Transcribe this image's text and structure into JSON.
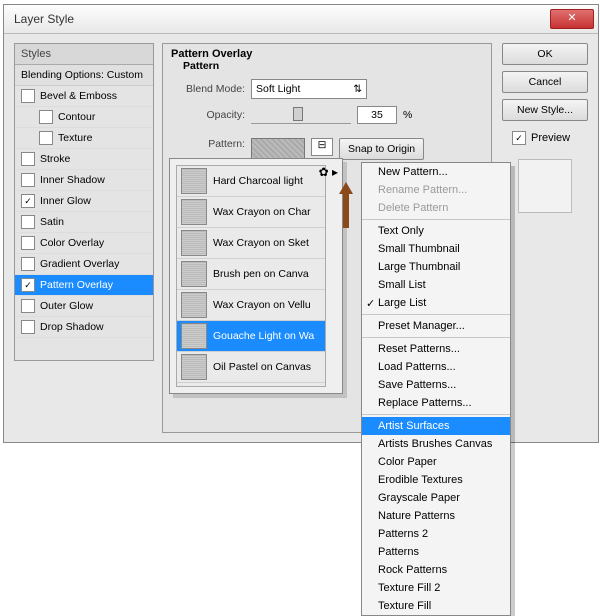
{
  "window": {
    "title": "Layer Style"
  },
  "styles_panel": {
    "header": "Styles",
    "subheader": "Blending Options: Custom",
    "items": [
      {
        "label": "Bevel & Emboss",
        "checked": false,
        "indent": false
      },
      {
        "label": "Contour",
        "checked": false,
        "indent": true
      },
      {
        "label": "Texture",
        "checked": false,
        "indent": true
      },
      {
        "label": "Stroke",
        "checked": false,
        "indent": false
      },
      {
        "label": "Inner Shadow",
        "checked": false,
        "indent": false
      },
      {
        "label": "Inner Glow",
        "checked": true,
        "indent": false
      },
      {
        "label": "Satin",
        "checked": false,
        "indent": false
      },
      {
        "label": "Color Overlay",
        "checked": false,
        "indent": false
      },
      {
        "label": "Gradient Overlay",
        "checked": false,
        "indent": false
      },
      {
        "label": "Pattern Overlay",
        "checked": true,
        "indent": false,
        "selected": true
      },
      {
        "label": "Outer Glow",
        "checked": false,
        "indent": false
      },
      {
        "label": "Drop Shadow",
        "checked": false,
        "indent": false
      }
    ]
  },
  "overlay": {
    "title": "Pattern Overlay",
    "section": "Pattern",
    "blend_label": "Blend Mode:",
    "blend_value": "Soft Light",
    "opacity_label": "Opacity:",
    "opacity_value": "35",
    "opacity_unit": "%",
    "pattern_label": "Pattern:",
    "snap_btn": "Snap to Origin"
  },
  "sidebar_buttons": {
    "ok": "OK",
    "cancel": "Cancel",
    "new_style": "New Style...",
    "preview": "Preview",
    "preview_checked": true
  },
  "pattern_list": [
    "Hard Charcoal light",
    "Wax Crayon on Char",
    "Wax Crayon on Sket",
    "Brush pen on Canva",
    "Wax Crayon on Vellu",
    "Gouache Light on Wa",
    "Oil Pastel on Canvas"
  ],
  "pattern_selected_index": 5,
  "context_menu": {
    "groups": [
      [
        {
          "label": "New Pattern..."
        },
        {
          "label": "Rename Pattern...",
          "disabled": true
        },
        {
          "label": "Delete Pattern",
          "disabled": true
        }
      ],
      [
        {
          "label": "Text Only"
        },
        {
          "label": "Small Thumbnail"
        },
        {
          "label": "Large Thumbnail"
        },
        {
          "label": "Small List"
        },
        {
          "label": "Large List",
          "checked": true
        }
      ],
      [
        {
          "label": "Preset Manager..."
        }
      ],
      [
        {
          "label": "Reset Patterns..."
        },
        {
          "label": "Load Patterns..."
        },
        {
          "label": "Save Patterns..."
        },
        {
          "label": "Replace Patterns..."
        }
      ],
      [
        {
          "label": "Artist Surfaces",
          "selected": true
        },
        {
          "label": "Artists Brushes Canvas"
        },
        {
          "label": "Color Paper"
        },
        {
          "label": "Erodible Textures"
        },
        {
          "label": "Grayscale Paper"
        },
        {
          "label": "Nature Patterns"
        },
        {
          "label": "Patterns 2"
        },
        {
          "label": "Patterns"
        },
        {
          "label": "Rock Patterns"
        },
        {
          "label": "Texture Fill 2"
        },
        {
          "label": "Texture Fill"
        }
      ]
    ]
  }
}
